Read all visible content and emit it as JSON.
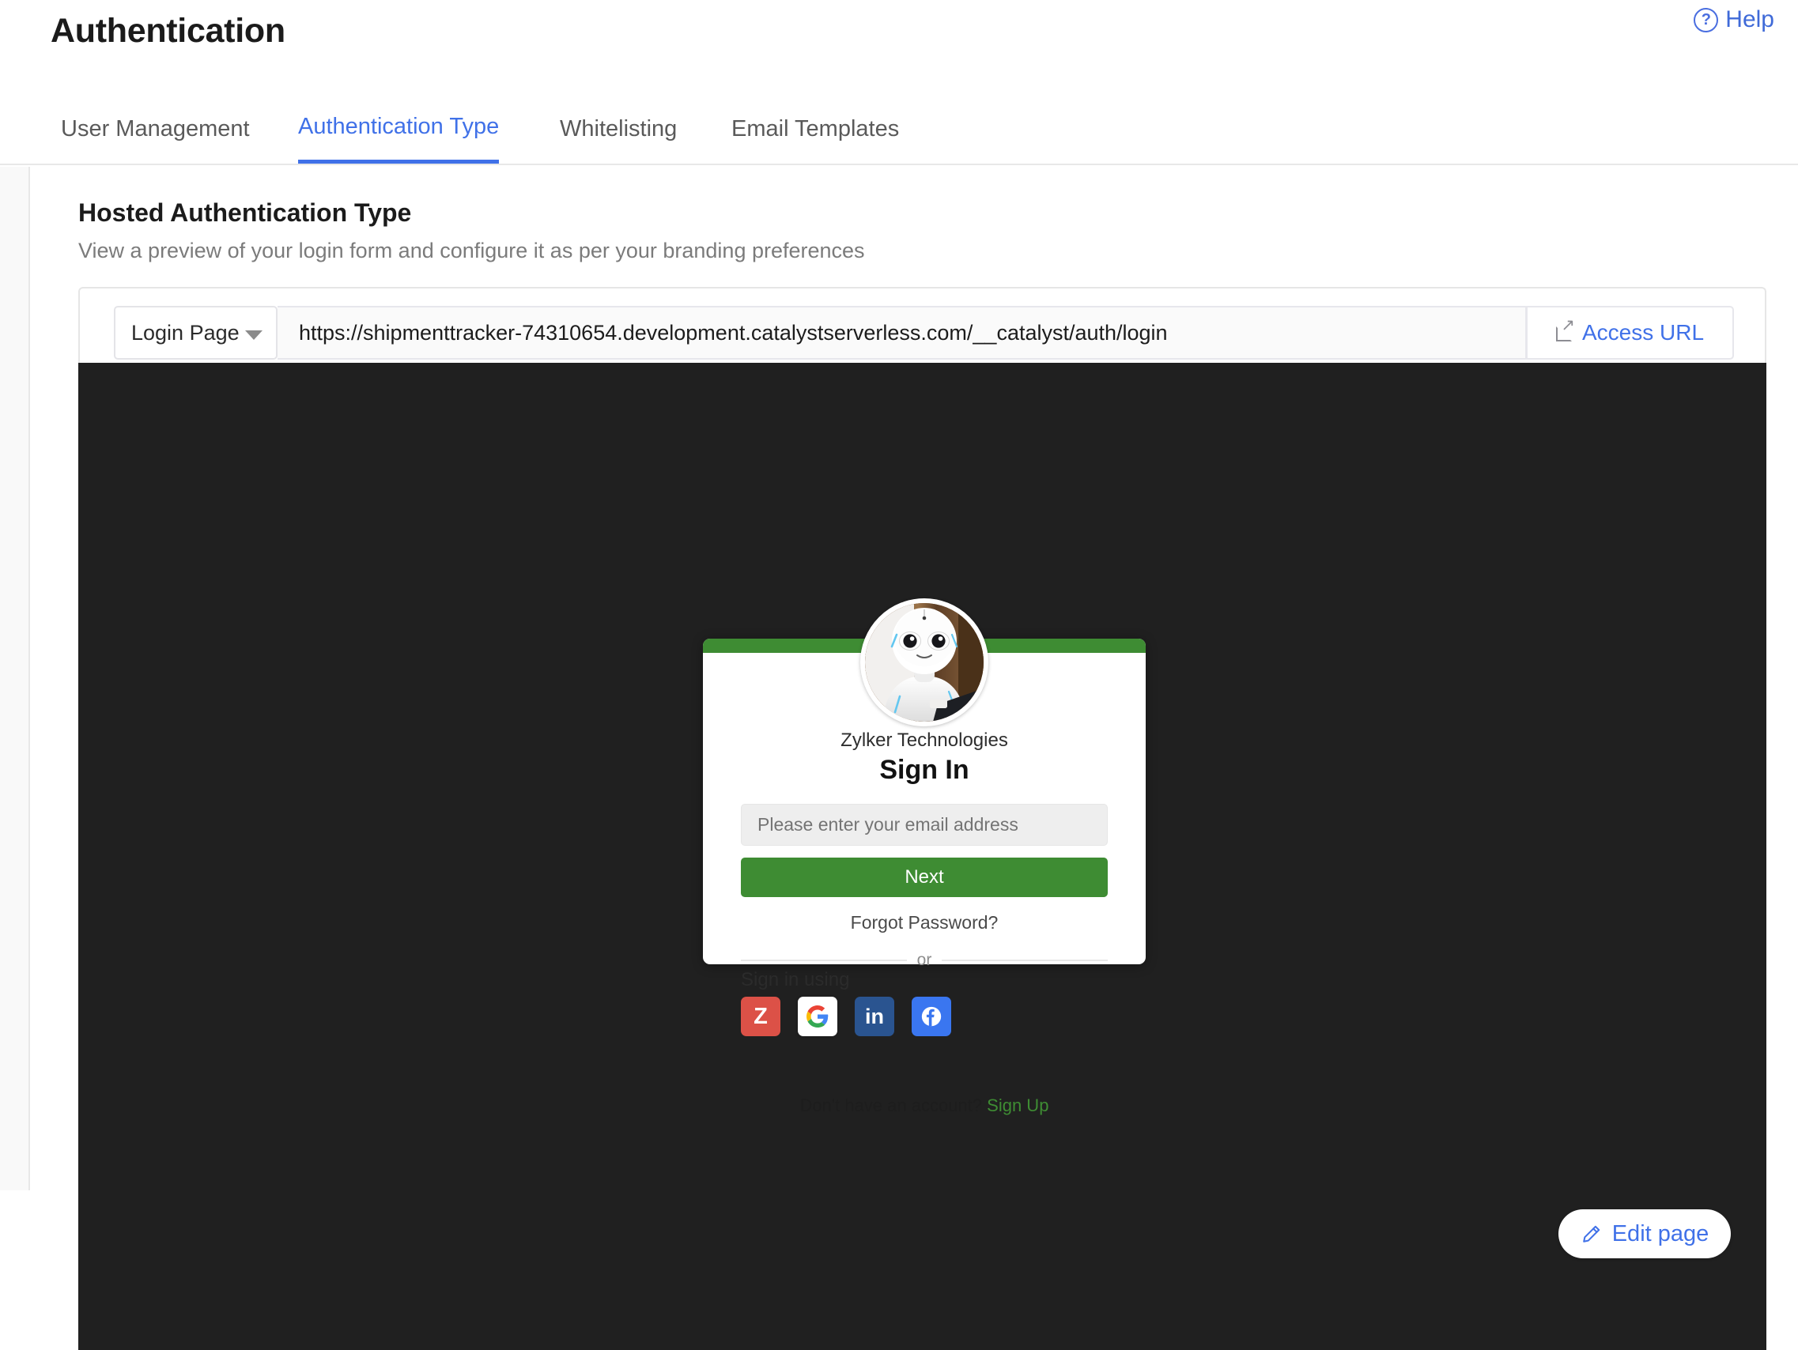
{
  "header": {
    "title": "Authentication",
    "help_label": "Help",
    "help_icon": "question-circle-icon"
  },
  "tabs": [
    {
      "label": "User Management",
      "active": false
    },
    {
      "label": "Authentication Type",
      "active": true
    },
    {
      "label": "Whitelisting",
      "active": false
    },
    {
      "label": "Email Templates",
      "active": false
    }
  ],
  "section": {
    "title": "Hosted Authentication Type",
    "subtitle": "View a preview of your login form and configure it as per your branding preferences"
  },
  "url_bar": {
    "page_select_value": "Login Page",
    "page_select_icon": "chevron-down-icon",
    "url": "https://shipmenttracker-74310654.development.catalystserverless.com/__catalyst/auth/login",
    "access_button_label": "Access URL",
    "access_button_icon": "external-link-icon"
  },
  "preview": {
    "background_color": "#202020",
    "accent_color": "#3e8c33",
    "avatar_alt": "robot-profile-photo",
    "org_name": "Zylker Technologies",
    "signin_title": "Sign In",
    "email_placeholder": "Please enter your email address",
    "email_value": "",
    "next_label": "Next",
    "forgot_password_label": "Forgot Password?",
    "or_label": "or",
    "sign_in_using_label": "Sign in using",
    "social": [
      {
        "name": "zoho",
        "glyph": "Z",
        "color": "#dc5147"
      },
      {
        "name": "google",
        "glyph": "G",
        "color": "#ffffff"
      },
      {
        "name": "linkedin",
        "glyph": "in",
        "color": "#2a5490"
      },
      {
        "name": "facebook",
        "glyph": "f",
        "color": "#3a76f0"
      }
    ],
    "footer_text": "Don't have an account?",
    "signup_label": "Sign Up",
    "signup_color": "#3e8c33"
  },
  "edit_page": {
    "label": "Edit page",
    "icon": "pencil-icon"
  }
}
